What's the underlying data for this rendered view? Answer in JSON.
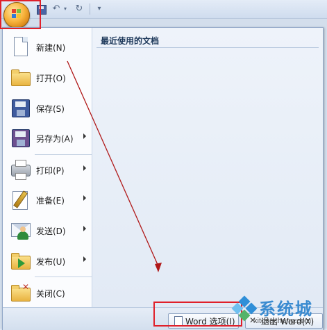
{
  "menu": {
    "items": [
      {
        "label": "新建(N)",
        "icon": "new-document-icon",
        "submenu": false
      },
      {
        "label": "打开(O)",
        "icon": "open-folder-icon",
        "submenu": false
      },
      {
        "label": "保存(S)",
        "icon": "save-disk-icon",
        "submenu": false
      },
      {
        "label": "另存为(A)",
        "icon": "save-as-icon",
        "submenu": true
      },
      {
        "label": "打印(P)",
        "icon": "printer-icon",
        "submenu": true
      },
      {
        "label": "准备(E)",
        "icon": "prepare-icon",
        "submenu": true
      },
      {
        "label": "发送(D)",
        "icon": "send-icon",
        "submenu": true
      },
      {
        "label": "发布(U)",
        "icon": "publish-icon",
        "submenu": true
      },
      {
        "label": "关闭(C)",
        "icon": "close-document-icon",
        "submenu": false
      }
    ],
    "recent_title": "最近使用的文档",
    "options_label": "Word 选项(I)",
    "exit_label": "退出 Word(X)"
  },
  "qat": {
    "customize_glyph": "▾"
  },
  "watermark": {
    "brand": "系统城",
    "url": "xitongcheng.com"
  },
  "colors": {
    "highlight": "#e0202a",
    "arrow": "#b01818"
  }
}
